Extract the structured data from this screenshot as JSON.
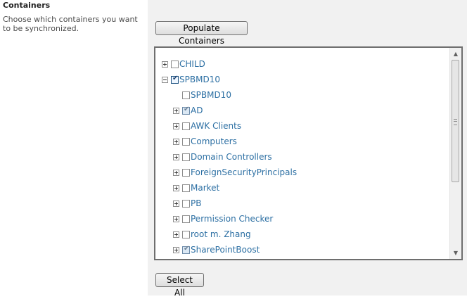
{
  "section": {
    "title": "Containers",
    "description": "Choose which containers you want to be synchronized."
  },
  "buttons": {
    "populate_label": "Populate Containers",
    "select_all_label": "Select All"
  },
  "tree": {
    "nodes": [
      {
        "label": "CHILD",
        "level": 0,
        "expander": "plus",
        "check": "unchecked"
      },
      {
        "label": "SPBMD10",
        "level": 0,
        "expander": "minus",
        "check": "checked"
      },
      {
        "label": "SPBMD10",
        "level": 1,
        "expander": "none",
        "check": "unchecked"
      },
      {
        "label": "AD",
        "level": 1,
        "expander": "plus",
        "check": "partial"
      },
      {
        "label": "AWK Clients",
        "level": 1,
        "expander": "plus",
        "check": "unchecked"
      },
      {
        "label": "Computers",
        "level": 1,
        "expander": "plus",
        "check": "unchecked"
      },
      {
        "label": "Domain Controllers",
        "level": 1,
        "expander": "plus",
        "check": "unchecked"
      },
      {
        "label": "ForeignSecurityPrincipals",
        "level": 1,
        "expander": "plus",
        "check": "unchecked"
      },
      {
        "label": "Market",
        "level": 1,
        "expander": "plus",
        "check": "unchecked"
      },
      {
        "label": "PB",
        "level": 1,
        "expander": "plus",
        "check": "unchecked"
      },
      {
        "label": "Permission Checker",
        "level": 1,
        "expander": "plus",
        "check": "unchecked"
      },
      {
        "label": "root m. Zhang",
        "level": 1,
        "expander": "plus",
        "check": "unchecked"
      },
      {
        "label": "SharePointBoost",
        "level": 1,
        "expander": "plus",
        "check": "partial"
      }
    ]
  },
  "colors": {
    "link": "#2c6fa3",
    "panel_background": "#f1f1f1",
    "tree_border": "#6e6e6e"
  }
}
